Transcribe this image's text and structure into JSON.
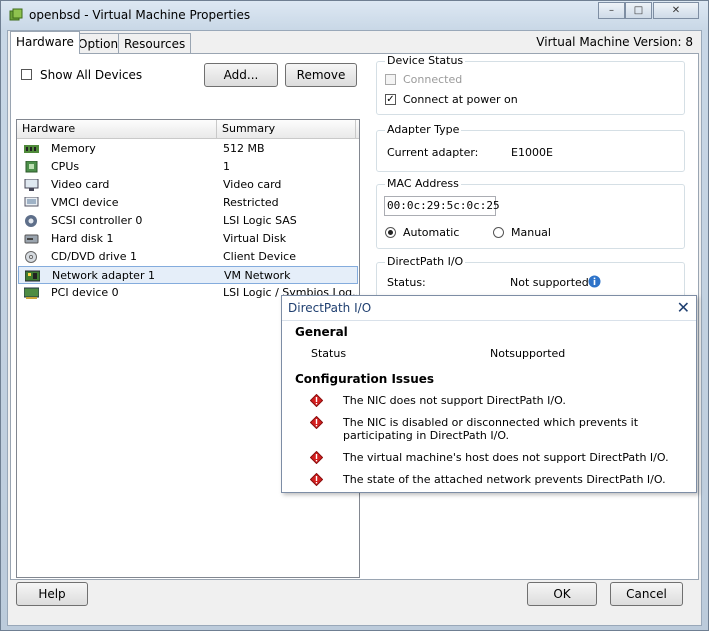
{
  "window": {
    "title": "openbsd - Virtual Machine Properties",
    "icon": "vm-icon",
    "controls": [
      "minimize-icon",
      "maximize-icon",
      "close-icon"
    ]
  },
  "tabs": [
    {
      "label": "Hardware",
      "active": true
    },
    {
      "label": "Options",
      "active": false
    },
    {
      "label": "Resources",
      "active": false
    }
  ],
  "version_label": "Virtual Machine Version: 8",
  "toolbar": {
    "show_all_devices": "Show All Devices",
    "add_label": "Add...",
    "remove_label": "Remove"
  },
  "hardware_list": {
    "columns": [
      "Hardware",
      "Summary"
    ],
    "rows": [
      {
        "name": "Memory",
        "summary": "512 MB",
        "icon": "memory-icon"
      },
      {
        "name": "CPUs",
        "summary": "1",
        "icon": "cpu-icon"
      },
      {
        "name": "Video card",
        "summary": "Video card",
        "icon": "video-card-icon"
      },
      {
        "name": "VMCI device",
        "summary": "Restricted",
        "icon": "vmci-icon"
      },
      {
        "name": "SCSI controller 0",
        "summary": "LSI Logic SAS",
        "icon": "scsi-icon"
      },
      {
        "name": "Hard disk 1",
        "summary": "Virtual Disk",
        "icon": "hard-disk-icon"
      },
      {
        "name": "CD/DVD drive 1",
        "summary": "Client Device",
        "icon": "cd-dvd-icon"
      },
      {
        "name": "Network adapter 1",
        "summary": "VM Network",
        "icon": "network-adapter-icon",
        "selected": true
      },
      {
        "name": "PCI device 0",
        "summary": "LSI Logic / Symbios Log...",
        "icon": "pci-icon"
      }
    ]
  },
  "device_status": {
    "title": "Device Status",
    "connected": "Connected",
    "connect_at_power_on": "Connect at power on"
  },
  "adapter_type": {
    "title": "Adapter Type",
    "label": "Current adapter:",
    "value": "E1000E"
  },
  "mac_address": {
    "title": "MAC Address",
    "value": "00:0c:29:5c:0c:25",
    "automatic": "Automatic",
    "manual": "Manual"
  },
  "directpath": {
    "title": "DirectPath I/O",
    "status_label": "Status:",
    "status_value": "Not supported"
  },
  "popup": {
    "title": "DirectPath I/O",
    "general_heading": "General",
    "status_label": "Status",
    "status_value": "Notsupported",
    "issues_heading": "Configuration Issues",
    "issues": [
      "The NIC does not support DirectPath I/O.",
      "The NIC is disabled or disconnected which prevents it participating in DirectPath I/O.",
      "The virtual machine's host does not support DirectPath I/O.",
      "The state of the attached network prevents DirectPath I/O."
    ]
  },
  "footer": {
    "help": "Help",
    "ok": "OK",
    "cancel": "Cancel"
  }
}
